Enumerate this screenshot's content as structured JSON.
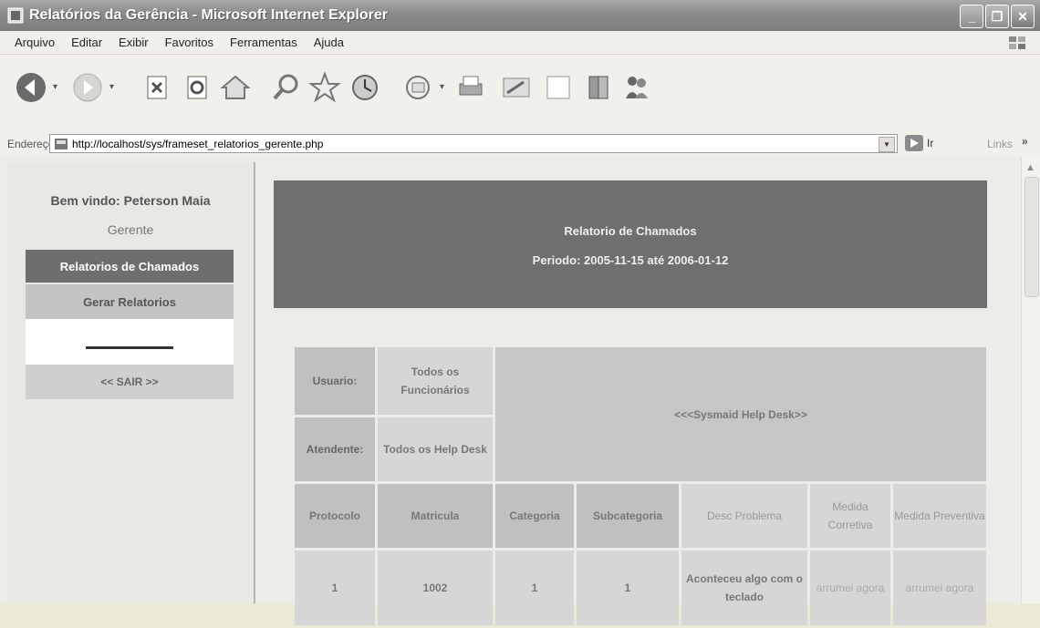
{
  "window": {
    "title": "Relatórios da Gerência - Microsoft Internet Explorer",
    "minimize": "_",
    "maximize": "❐",
    "close": "✕"
  },
  "menu": {
    "items": [
      "Arquivo",
      "Editar",
      "Exibir",
      "Favoritos",
      "Ferramentas",
      "Ajuda"
    ]
  },
  "toolbar": {
    "icons": [
      "back-icon",
      "forward-icon",
      "stop-icon",
      "refresh-icon",
      "home-icon",
      "search-icon",
      "favorites-icon",
      "history-icon",
      "mail-icon",
      "print-icon",
      "edit-icon",
      "discuss-icon",
      "research-icon",
      "messenger-icon"
    ]
  },
  "address": {
    "label": "Endereço",
    "url": "http://localhost/sys/frameset_relatorios_gerente.php",
    "go_label": "Ir",
    "links_label": "Links",
    "more": "»"
  },
  "sidebar": {
    "welcome": "Bem vindo: Peterson Maia",
    "role": "Gerente",
    "active_item": "Relatorios de Chamados",
    "item": "Gerar Relatorios",
    "exit": "<< SAIR >>"
  },
  "report": {
    "title": "Relatorio de Chamados",
    "period": "Periodo: 2005-11-15 até 2006-01-12",
    "user_label": "Usuario:",
    "user_value": "Todos os Funcionários",
    "attendant_label": "Atendente:",
    "attendant_value": "Todos os Help Desk",
    "system_name": "<<<Sysmaid Help Desk>>",
    "columns": [
      "Protocolo",
      "Matricula",
      "Categoria",
      "Subcategoria",
      "Desc Problema",
      "Medida Corretiva",
      "Medida Preventiva"
    ],
    "rows": [
      [
        "1",
        "1002",
        "1",
        "1",
        "Aconteceu algo com o teclado",
        "arrumei agora",
        "arrumei agora"
      ]
    ]
  },
  "colors": {
    "titlebar": "#8c8c8c",
    "banner": "#6f6f6f",
    "nav_active": "#6e6e6e",
    "table_cell": "#c0c0c0"
  }
}
